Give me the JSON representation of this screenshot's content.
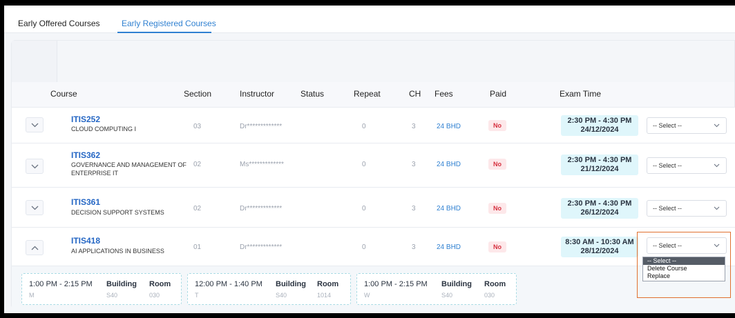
{
  "tabs": [
    {
      "label": "Early Offered Courses"
    },
    {
      "label": "Early Registered Courses"
    }
  ],
  "columns": {
    "course": "Course",
    "section": "Section",
    "instructor": "Instructor",
    "status": "Status",
    "repeat": "Repeat",
    "ch": "CH",
    "fees": "Fees",
    "paid": "Paid",
    "exam_time": "Exam Time"
  },
  "rows": [
    {
      "code": "ITIS252",
      "name_1": "CLOUD COMPUTING I",
      "name_2": "",
      "section": "03",
      "instructor": "Dr*************",
      "repeat": "0",
      "ch": "3",
      "fees": "24 BHD",
      "paid": "No",
      "exam_time": "2:30 PM - 4:30 PM",
      "exam_date": "24/12/2024",
      "action": "-- Select --",
      "expanded": false
    },
    {
      "code": "ITIS362",
      "name_1": "GOVERNANCE AND MANAGEMENT OF",
      "name_2": "ENTERPRISE IT",
      "section": "02",
      "instructor": "Ms*************",
      "repeat": "0",
      "ch": "3",
      "fees": "24 BHD",
      "paid": "No",
      "exam_time": "2:30 PM - 4:30 PM",
      "exam_date": "21/12/2024",
      "action": "-- Select --",
      "expanded": false
    },
    {
      "code": "ITIS361",
      "name_1": "DECISION SUPPORT SYSTEMS",
      "name_2": "",
      "section": "02",
      "instructor": "Dr*************",
      "repeat": "0",
      "ch": "3",
      "fees": "24 BHD",
      "paid": "No",
      "exam_time": "2:30 PM - 4:30 PM",
      "exam_date": "26/12/2024",
      "action": "-- Select --",
      "expanded": false
    },
    {
      "code": "ITIS418",
      "name_1": "AI APPLICATIONS IN BUSINESS",
      "name_2": "",
      "section": "01",
      "instructor": "Dr*************",
      "repeat": "0",
      "ch": "3",
      "fees": "24 BHD",
      "paid": "No",
      "exam_time": "8:30 AM - 10:30 AM",
      "exam_date": "28/12/2024",
      "action": "-- Select --",
      "expanded": true
    }
  ],
  "schedule": [
    {
      "time": "1:00 PM - 2:15 PM",
      "day": "M",
      "building_label": "Building",
      "building": "S40",
      "room_label": "Room",
      "room": "030"
    },
    {
      "time": "12:00 PM - 1:40 PM",
      "day": "T",
      "building_label": "Building",
      "building": "S40",
      "room_label": "Room",
      "room": "1014"
    },
    {
      "time": "1:00 PM - 2:15 PM",
      "day": "W",
      "building_label": "Building",
      "building": "S40",
      "room_label": "Room",
      "room": "030"
    }
  ],
  "dropdown_options": [
    "-- Select --",
    "Delete Course",
    "Replace"
  ],
  "colors": {
    "accent": "#2f80d1",
    "course_code": "#2466c4",
    "paid_no": "#d6303f",
    "exam_bg": "#dff6fb",
    "highlight": "#e0702e"
  },
  "icons": {
    "collapsed": "chevron-down-icon",
    "expanded": "chevron-up-icon",
    "select": "chevron-down-icon"
  }
}
